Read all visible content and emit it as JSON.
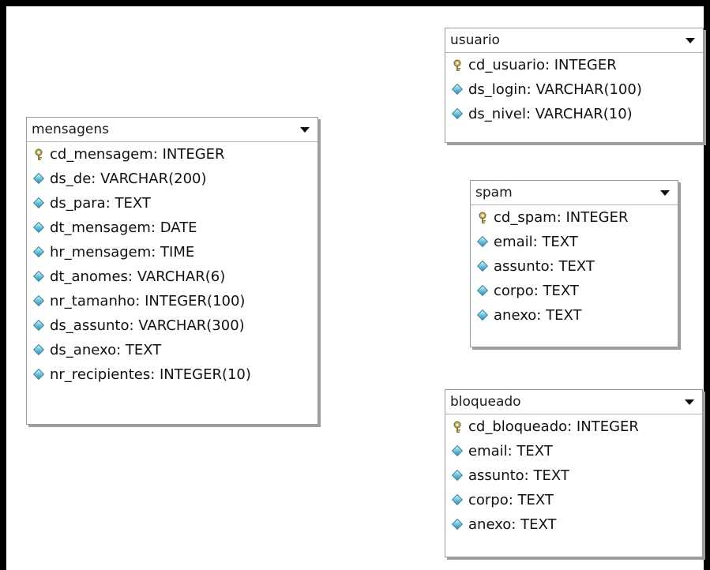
{
  "tables": {
    "mensagens": {
      "title": "mensagens",
      "fields": [
        {
          "label": "cd_mensagem: INTEGER",
          "icon": "key-icon"
        },
        {
          "label": "ds_de: VARCHAR(200)",
          "icon": "column-diamond-icon"
        },
        {
          "label": "ds_para: TEXT",
          "icon": "column-diamond-icon"
        },
        {
          "label": "dt_mensagem: DATE",
          "icon": "column-diamond-icon"
        },
        {
          "label": "hr_mensagem: TIME",
          "icon": "column-diamond-icon"
        },
        {
          "label": "dt_anomes: VARCHAR(6)",
          "icon": "column-diamond-icon"
        },
        {
          "label": "nr_tamanho: INTEGER(100)",
          "icon": "column-diamond-icon"
        },
        {
          "label": "ds_assunto: VARCHAR(300)",
          "icon": "column-diamond-icon"
        },
        {
          "label": "ds_anexo: TEXT",
          "icon": "column-diamond-icon"
        },
        {
          "label": "nr_recipientes: INTEGER(10)",
          "icon": "column-diamond-icon"
        }
      ]
    },
    "usuario": {
      "title": "usuario",
      "fields": [
        {
          "label": "cd_usuario: INTEGER",
          "icon": "key-icon"
        },
        {
          "label": "ds_login: VARCHAR(100)",
          "icon": "column-diamond-icon"
        },
        {
          "label": "ds_nivel: VARCHAR(10)",
          "icon": "column-diamond-icon"
        }
      ]
    },
    "spam": {
      "title": "spam",
      "fields": [
        {
          "label": "cd_spam: INTEGER",
          "icon": "key-icon"
        },
        {
          "label": "email: TEXT",
          "icon": "column-diamond-icon"
        },
        {
          "label": "assunto: TEXT",
          "icon": "column-diamond-icon"
        },
        {
          "label": "corpo: TEXT",
          "icon": "column-diamond-icon"
        },
        {
          "label": "anexo: TEXT",
          "icon": "column-diamond-icon"
        }
      ]
    },
    "bloqueado": {
      "title": "bloqueado",
      "fields": [
        {
          "label": "cd_bloqueado: INTEGER",
          "icon": "key-icon"
        },
        {
          "label": "email: TEXT",
          "icon": "column-diamond-icon"
        },
        {
          "label": "assunto: TEXT",
          "icon": "column-diamond-icon"
        },
        {
          "label": "corpo: TEXT",
          "icon": "column-diamond-icon"
        },
        {
          "label": "anexo: TEXT",
          "icon": "column-diamond-icon"
        }
      ]
    }
  },
  "colors": {
    "border": "#9a9a9a",
    "shadow": "#9e9e9e",
    "diamond": "#55b3cf",
    "key": "#9b8a42"
  }
}
